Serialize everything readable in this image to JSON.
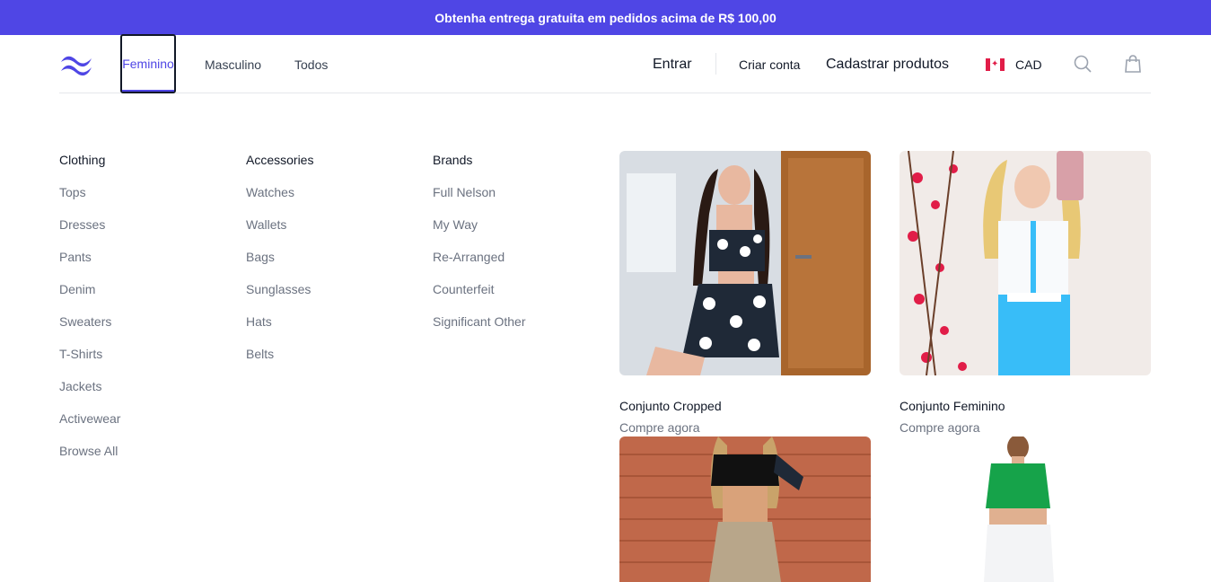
{
  "banner": {
    "text": "Obtenha entrega gratuita em pedidos acima de R$ 100,00"
  },
  "nav": {
    "logo": "tailwind-logo-icon",
    "items": [
      {
        "label": "Feminino",
        "active": true
      },
      {
        "label": "Masculino",
        "active": false
      },
      {
        "label": "Todos",
        "active": false
      }
    ]
  },
  "account": {
    "login": "Entrar",
    "register": "Criar conta",
    "add_products": "Cadastrar produtos",
    "currency": "CAD",
    "flag": "canada-flag-icon",
    "search_icon": "search-icon",
    "cart_icon": "shopping-bag-icon"
  },
  "menu": {
    "columns": [
      {
        "title": "Clothing",
        "items": [
          "Tops",
          "Dresses",
          "Pants",
          "Denim",
          "Sweaters",
          "T-Shirts",
          "Jackets",
          "Activewear",
          "Browse All"
        ]
      },
      {
        "title": "Accessories",
        "items": [
          "Watches",
          "Wallets",
          "Bags",
          "Sunglasses",
          "Hats",
          "Belts"
        ]
      },
      {
        "title": "Brands",
        "items": [
          "Full Nelson",
          "My Way",
          "Re-Arranged",
          "Counterfeit",
          "Significant Other"
        ]
      }
    ],
    "featured": [
      {
        "title": "Conjunto Cropped",
        "cta": "Compre agora"
      },
      {
        "title": "Conjunto Feminino",
        "cta": "Compre agora"
      },
      {
        "title": "",
        "cta": ""
      },
      {
        "title": "",
        "cta": ""
      }
    ]
  },
  "colors": {
    "accent": "#4f46e5",
    "text": "#111827",
    "muted": "#6b7280",
    "border": "#e5e7eb"
  }
}
